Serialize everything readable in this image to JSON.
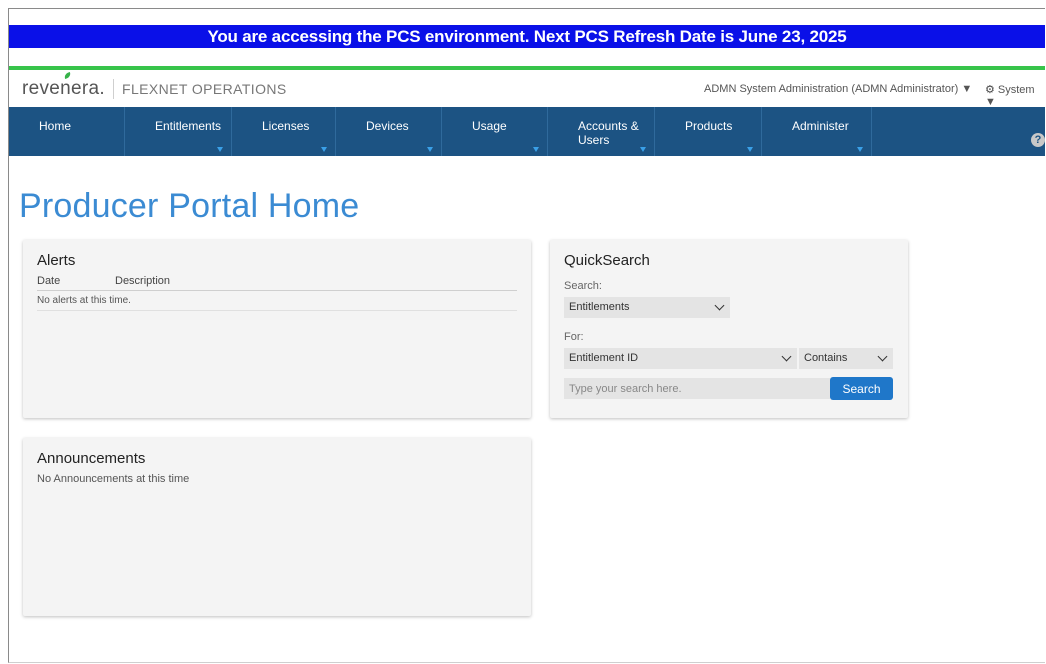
{
  "banner": {
    "text": "You are accessing the PCS environment. Next PCS Refresh Date is June 23, 2025"
  },
  "brand": {
    "logo_text": "revenera.",
    "product_name": "FLEXNET OPERATIONS",
    "user_menu": "ADMN System Administration (ADMN Administrator) ▼",
    "system_menu": "System ▼"
  },
  "nav": {
    "items": [
      {
        "label": "Home"
      },
      {
        "label": "Entitlements"
      },
      {
        "label": "Licenses"
      },
      {
        "label": "Devices"
      },
      {
        "label": "Usage"
      },
      {
        "label": "Accounts &",
        "label2": "Users"
      },
      {
        "label": "Products"
      },
      {
        "label": "Administer"
      }
    ],
    "help": "?"
  },
  "page": {
    "title": "Producer Portal Home"
  },
  "alerts": {
    "title": "Alerts",
    "columns": [
      "Date",
      "Description"
    ],
    "empty_text": "No alerts at this time."
  },
  "quicksearch": {
    "title": "QuickSearch",
    "search_label": "Search:",
    "search_value": "Entitlements",
    "for_label": "For:",
    "for_value": "Entitlement ID",
    "match_value": "Contains",
    "input_placeholder": "Type your search here.",
    "button_label": "Search"
  },
  "announcements": {
    "title": "Announcements",
    "empty_text": "No Announcements at this time"
  },
  "colors": {
    "banner_bg": "#0a10e8",
    "accent_green": "#37c44a",
    "nav_bg": "#1c5383",
    "title_blue": "#3b8bd3",
    "button_blue": "#1f77c9"
  }
}
